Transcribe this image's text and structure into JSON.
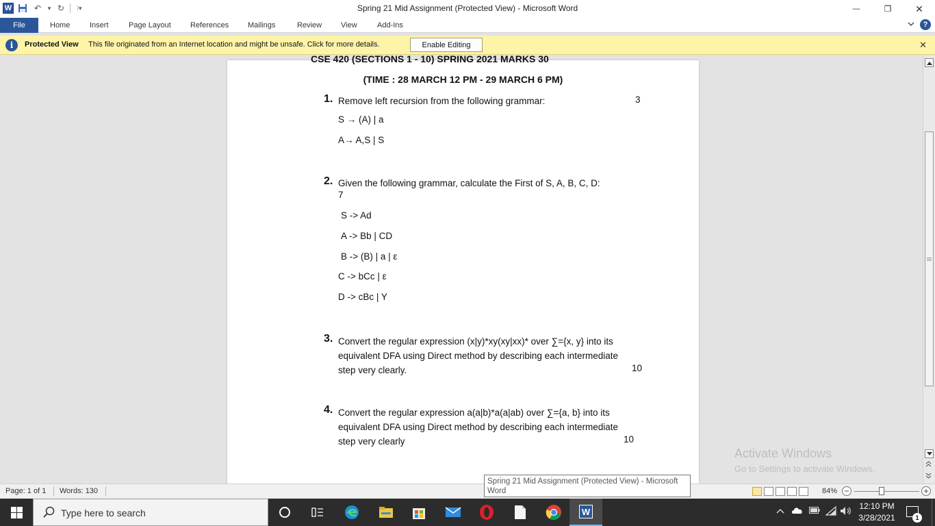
{
  "window": {
    "title": "Spring 21 Mid Assignment (Protected View)  -  Microsoft Word",
    "word_logo": "W",
    "minimize_glyph": "—",
    "restore_glyph": "❐",
    "close_glyph": "✕"
  },
  "quick_access": {
    "save_glyph": "💾",
    "undo_glyph": "↶",
    "dropdown_glyph": "▾",
    "redo_glyph": "↻",
    "customize_glyph": "⁞▾"
  },
  "ribbon": {
    "tabs": [
      "File",
      "Home",
      "Insert",
      "Page Layout",
      "References",
      "Mailings",
      "Review",
      "View",
      "Add-Ins"
    ],
    "collapse_glyph": "♡",
    "help_glyph": "?"
  },
  "protected_view": {
    "title": "Protected View",
    "message": "This file originated from an Internet location and might be unsafe. Click for more details.",
    "enable_button": "Enable Editing",
    "info_glyph": "i",
    "close_glyph": "✕",
    "accent_color": "#fef4a8"
  },
  "document": {
    "header_cut": "CSE 420 (SECTIONS 1 - 10)           SPRING 2021           MARKS 30",
    "time_line": "(TIME : 28 MARCH 12 PM - 29 MARCH 6 PM)",
    "q1": {
      "num": "1.",
      "text": "Remove left recursion from the following grammar:",
      "marks": "3",
      "grammar": [
        "S → (A) | a",
        "A→ A,S | S"
      ]
    },
    "q2": {
      "num": "2.",
      "text": "Given the following grammar, calculate the First of S, A, B, C, D:",
      "marks": "7",
      "grammar": [
        "S -> Ad",
        "A -> Bb | CD",
        "B -> (B) | a  | ε",
        "C -> bCc | ε",
        "D -> cBc | Y"
      ]
    },
    "q3": {
      "num": "3.",
      "lines": [
        "Convert the regular expression (x|y)*xy(xy|xx)* over ∑={x, y} into its",
        "equivalent DFA using Direct method by describing each intermediate",
        "step very clearly."
      ],
      "marks": "10"
    },
    "q4": {
      "num": "4.",
      "lines": [
        "Convert the regular expression a(a|b)*a(a|ab) over ∑={a, b} into its",
        "equivalent DFA using Direct method by describing each intermediate",
        "step very clearly"
      ],
      "marks": "10"
    }
  },
  "watermark": {
    "line1": "Activate Windows",
    "line2": "Go to Settings to activate Windows."
  },
  "tooltip": {
    "text": "Spring 21 Mid Assignment (Protected View) - Microsoft Word"
  },
  "status": {
    "page": "Page: 1 of 1",
    "words": "Words: 130",
    "zoom": "84%",
    "zoom_level": 0.84
  },
  "taskbar": {
    "search_placeholder": "Type here to search",
    "time": "12:10 PM",
    "date": "3/28/2021",
    "notification_count": "1",
    "word_label": "W"
  }
}
